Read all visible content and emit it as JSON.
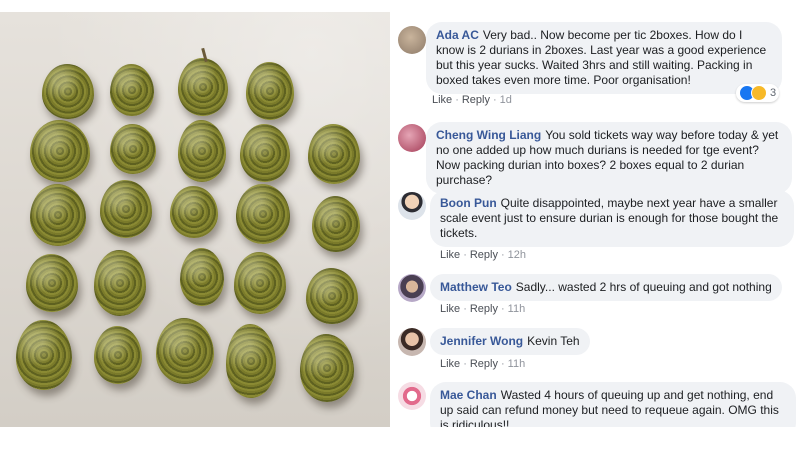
{
  "comments": [
    {
      "name": "Ada AC",
      "text": "Very bad.. Now become per tic 2boxes. How do I know is 2 durians in 2boxes. Last year was a good experience but this year sucks. Waited 3hrs and still waiting. Packing in boxed takes even more time. Poor organisation!",
      "like": "Like",
      "reply": "Reply",
      "time": "1d",
      "reactions": "3"
    },
    {
      "name": "Cheng Wing Liang",
      "text": "You sold tickets way way before today & yet no one added up how much durians is needed for tge event? Now packing durian into boxes? 2 boxes equal to 2 durian purchase?"
    },
    {
      "name": "Boon Pun",
      "text": "Quite disappointed, maybe next year have a smaller scale event just to ensure durian is enough for those bought the tickets.",
      "like": "Like",
      "reply": "Reply",
      "time": "12h"
    },
    {
      "name": "Matthew Teo",
      "text": "Sadly... wasted 2 hrs of queuing and got nothing",
      "like": "Like",
      "reply": "Reply",
      "time": "11h"
    },
    {
      "name": "Jennifer Wong",
      "text": "Kevin Teh",
      "like": "Like",
      "reply": "Reply",
      "time": "11h"
    },
    {
      "name": "Mae Chan",
      "text": "Wasted 4 hours of queuing up and get nothing, end up said can refund money but need to requeue again. OMG this is ridiculous!!"
    }
  ],
  "colors": {
    "link": "#385898",
    "bubble": "#f0f2f5",
    "like_blue": "#1877f2",
    "haha_yellow": "#f7b928"
  },
  "icons": [
    "like-reaction-icon",
    "haha-reaction-icon"
  ]
}
